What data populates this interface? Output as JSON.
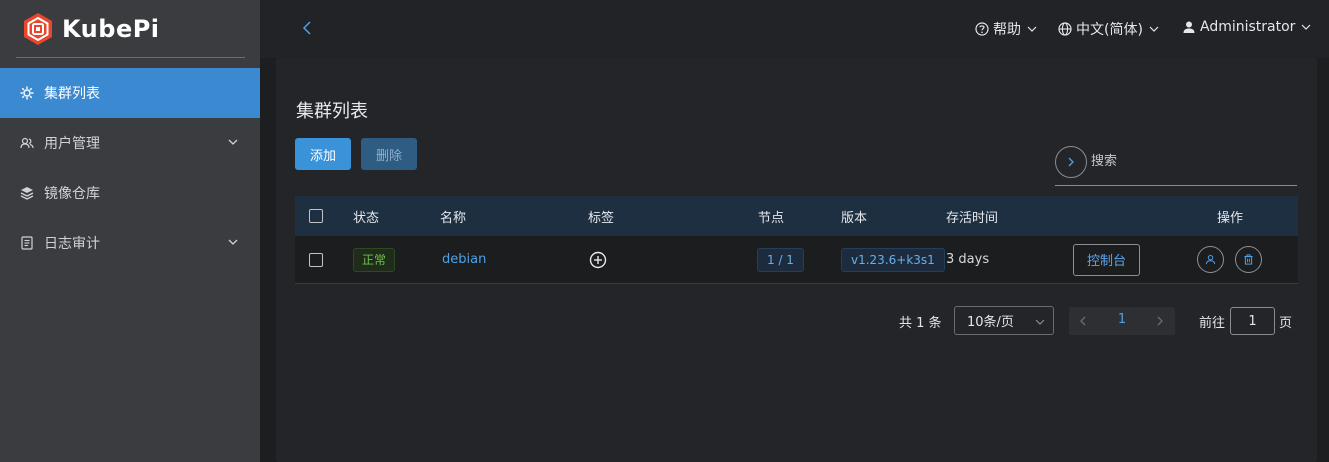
{
  "app": {
    "name": "KubePi",
    "brand_color": "#e8472b"
  },
  "sidebar": {
    "items": [
      {
        "label": "集群列表",
        "icon": "cluster-icon",
        "active": true,
        "expandable": false
      },
      {
        "label": "用户管理",
        "icon": "users-icon",
        "active": false,
        "expandable": true
      },
      {
        "label": "镜像仓库",
        "icon": "layers-icon",
        "active": false,
        "expandable": false
      },
      {
        "label": "日志审计",
        "icon": "document-icon",
        "active": false,
        "expandable": true
      }
    ]
  },
  "header": {
    "help_label": "帮助",
    "language_label": "中文(简体)",
    "user_label": "Administrator"
  },
  "main": {
    "title": "集群列表",
    "add_label": "添加",
    "delete_label": "删除",
    "search_placeholder": "搜索"
  },
  "table": {
    "columns": {
      "status": "状态",
      "name": "名称",
      "labels": "标签",
      "nodes": "节点",
      "version": "版本",
      "age": "存活时间",
      "actions": "操作"
    },
    "rows": [
      {
        "status": "正常",
        "name": "debian",
        "nodes": "1 / 1",
        "version": "v1.23.6+k3s1",
        "age": "3 days",
        "console_label": "控制台"
      }
    ]
  },
  "pagination": {
    "total_text": "共 1 条",
    "page_size": "10条/页",
    "current_page": "1",
    "goto_label": "前往",
    "goto_value": "1",
    "page_suffix": "页"
  },
  "colors": {
    "accent": "#3a93d9",
    "sidebar_active": "#3b8ad1",
    "success": "#6cc04a",
    "link": "#4ea0e8"
  }
}
